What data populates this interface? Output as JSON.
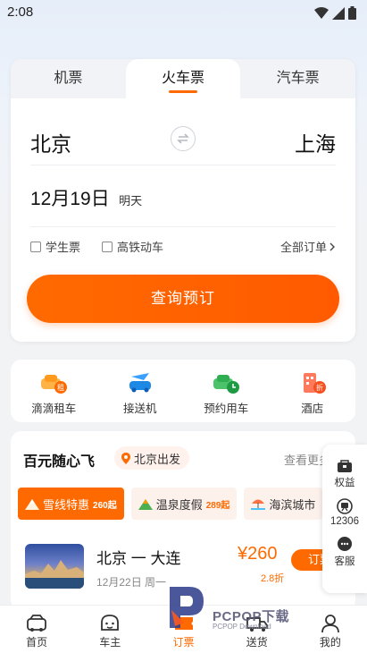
{
  "status": {
    "time": "2:08"
  },
  "tabs": [
    {
      "label": "机票",
      "active": false
    },
    {
      "label": "火车票",
      "active": true
    },
    {
      "label": "汽车票",
      "active": false
    }
  ],
  "route": {
    "from": "北京",
    "to": "上海"
  },
  "date": {
    "main": "12月19日",
    "sub": "明天"
  },
  "options": {
    "student": "学生票",
    "highspeed": "高铁动车",
    "all_orders": "全部订单"
  },
  "query_button": "查询预订",
  "services": [
    {
      "label": "滴滴租车",
      "icon": "car-rental-icon"
    },
    {
      "label": "接送机",
      "icon": "airport-transfer-icon"
    },
    {
      "label": "预约用车",
      "icon": "scheduled-car-icon"
    },
    {
      "label": "酒店",
      "icon": "hotel-icon"
    }
  ],
  "promo": {
    "title": "百元随心飞",
    "depart": "北京出发",
    "view_more": "查看更多",
    "chips": [
      {
        "label": "雪线特惠",
        "tag": "260起",
        "active": true
      },
      {
        "label": "温泉度假",
        "tag": "289起",
        "active": false
      },
      {
        "label": "海滨城市",
        "tag": "",
        "active": false
      }
    ],
    "trip": {
      "route": "北京 一 大连",
      "date": "12月22日 周一",
      "price": "¥260",
      "discount": "2.8折",
      "book": "订票"
    }
  },
  "side_panel": [
    {
      "label": "权益",
      "icon": "benefits-icon"
    },
    {
      "label": "12306",
      "icon": "railway-icon"
    },
    {
      "label": "客服",
      "icon": "customer-service-icon"
    }
  ],
  "bottom_nav": [
    {
      "label": "首页",
      "active": false
    },
    {
      "label": "车主",
      "active": false
    },
    {
      "label": "订票",
      "active": true
    },
    {
      "label": "送货",
      "active": false
    },
    {
      "label": "我的",
      "active": false
    }
  ],
  "watermark": {
    "text": "PCPOP下载",
    "sub": "PCPOP Download"
  },
  "colors": {
    "accent": "#ff6a00",
    "background": "#f2f3f5"
  }
}
